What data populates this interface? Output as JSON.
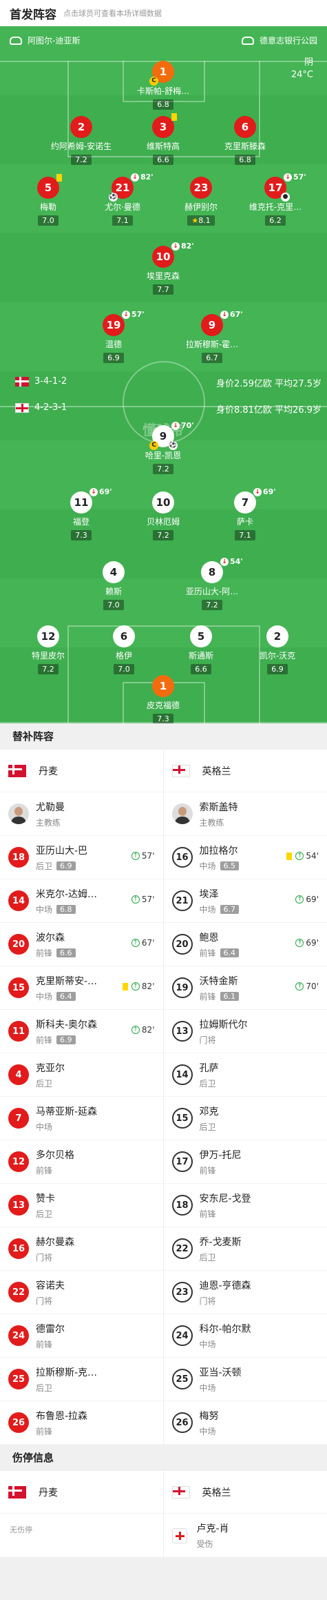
{
  "header": {
    "title": "首发阵容",
    "hint": "点击球员可查看本场详细数据"
  },
  "pitch": {
    "home_team": "阿图尔-迪亚斯",
    "away_team": "德意志银行公园",
    "weather": "阴",
    "temperature": "24°C",
    "watermark": "懂球帝",
    "dk_formation": "3-4-1-2",
    "dk_stats": "身价2.59亿欧  平均27.5岁",
    "en_formation": "4-2-3-1",
    "en_stats": "身价8.81亿欧  平均26.9岁"
  },
  "dk_players": [
    {
      "num": "1",
      "name": "卡斯帕-舒梅…",
      "rating": "6.8"
    },
    {
      "num": "2",
      "name": "约阿希姆-安诺生",
      "rating": "7.2"
    },
    {
      "num": "3",
      "name": "维斯特高",
      "rating": "6.6"
    },
    {
      "num": "6",
      "name": "克里斯滕森",
      "rating": "6.8"
    },
    {
      "num": "5",
      "name": "梅勒",
      "rating": "7.0"
    },
    {
      "num": "21",
      "name": "尤尔·曼德",
      "rating": "7.1",
      "sub": "82'"
    },
    {
      "num": "23",
      "name": "赫伊别尔",
      "rating": "8.1"
    },
    {
      "num": "17",
      "name": "维克托-克里…",
      "rating": "6.2",
      "sub": "57'"
    },
    {
      "num": "10",
      "name": "埃里克森",
      "rating": "7.7",
      "sub": "82'"
    },
    {
      "num": "19",
      "name": "温德",
      "rating": "6.9",
      "sub": "57'"
    },
    {
      "num": "9",
      "name": "拉斯穆斯-霍…",
      "rating": "6.7",
      "sub": "67'"
    }
  ],
  "en_players": [
    {
      "num": "9",
      "name": "哈里-凯恩",
      "rating": "7.2",
      "sub": "70'"
    },
    {
      "num": "11",
      "name": "福登",
      "rating": "7.3",
      "sub": "69'"
    },
    {
      "num": "10",
      "name": "贝林厄姆",
      "rating": "7.2"
    },
    {
      "num": "7",
      "name": "萨卡",
      "rating": "7.1",
      "sub": "69'"
    },
    {
      "num": "4",
      "name": "赖斯",
      "rating": "7.0"
    },
    {
      "num": "8",
      "name": "亚历山大-阿…",
      "rating": "7.2",
      "sub": "54'"
    },
    {
      "num": "12",
      "name": "特里皮尔",
      "rating": "7.2"
    },
    {
      "num": "6",
      "name": "格伊",
      "rating": "7.0"
    },
    {
      "num": "5",
      "name": "斯通斯",
      "rating": "6.6"
    },
    {
      "num": "2",
      "name": "凯尔-沃克",
      "rating": "6.9"
    },
    {
      "num": "1",
      "name": "皮克福德",
      "rating": "7.3"
    }
  ],
  "bench": {
    "title": "替补阵容",
    "dk_name": "丹麦",
    "en_name": "英格兰",
    "dk_coach": {
      "name": "尤勒曼",
      "role": "主教练"
    },
    "en_coach": {
      "name": "索斯盖特",
      "role": "主教练"
    },
    "dk": [
      {
        "num": "18",
        "name": "亚历山大-巴",
        "pos": "后卫",
        "rating": "6.9",
        "sub": "57'"
      },
      {
        "num": "14",
        "name": "米克尔-达姆…",
        "pos": "中场",
        "rating": "6.8",
        "sub": "57'"
      },
      {
        "num": "20",
        "name": "波尔森",
        "pos": "前锋",
        "rating": "6.6",
        "sub": "67'"
      },
      {
        "num": "15",
        "name": "克里斯蒂安-…",
        "pos": "中场",
        "rating": "6.4",
        "sub": "82'"
      },
      {
        "num": "11",
        "name": "斯科夫-奥尔森",
        "pos": "前锋",
        "rating": "6.9",
        "sub": "82'"
      },
      {
        "num": "4",
        "name": "克亚尔",
        "pos": "后卫"
      },
      {
        "num": "7",
        "name": "马蒂亚斯-延森",
        "pos": "中场"
      },
      {
        "num": "12",
        "name": "多尔贝格",
        "pos": "前锋"
      },
      {
        "num": "13",
        "name": "赞卡",
        "pos": "后卫"
      },
      {
        "num": "16",
        "name": "赫尔曼森",
        "pos": "门将"
      },
      {
        "num": "22",
        "name": "容诺夫",
        "pos": "门将"
      },
      {
        "num": "24",
        "name": "德雷尔",
        "pos": "前锋"
      },
      {
        "num": "25",
        "name": "拉斯穆斯-克…",
        "pos": "后卫"
      },
      {
        "num": "26",
        "name": "布鲁恩-拉森",
        "pos": "前锋"
      }
    ],
    "en": [
      {
        "num": "16",
        "name": "加拉格尔",
        "pos": "中场",
        "rating": "6.5",
        "sub": "54'"
      },
      {
        "num": "21",
        "name": "埃泽",
        "pos": "中场",
        "rating": "6.7",
        "sub": "69'"
      },
      {
        "num": "20",
        "name": "鲍恩",
        "pos": "前锋",
        "rating": "6.4",
        "sub": "69'"
      },
      {
        "num": "19",
        "name": "沃特金斯",
        "pos": "前锋",
        "rating": "6.1",
        "sub": "70'"
      },
      {
        "num": "13",
        "name": "拉姆斯代尔",
        "pos": "门将"
      },
      {
        "num": "14",
        "name": "孔萨",
        "pos": "后卫"
      },
      {
        "num": "15",
        "name": "邓克",
        "pos": "后卫"
      },
      {
        "num": "17",
        "name": "伊万-托尼",
        "pos": "前锋"
      },
      {
        "num": "18",
        "name": "安东尼-戈登",
        "pos": "前锋"
      },
      {
        "num": "22",
        "name": "乔-戈麦斯",
        "pos": "后卫"
      },
      {
        "num": "23",
        "name": "迪恩-亨德森",
        "pos": "门将"
      },
      {
        "num": "24",
        "name": "科尔-帕尔默",
        "pos": "中场"
      },
      {
        "num": "25",
        "name": "亚当-沃顿",
        "pos": "中场"
      },
      {
        "num": "26",
        "name": "梅努",
        "pos": "中场"
      }
    ]
  },
  "injury": {
    "title": "伤停信息",
    "dk_name": "丹麦",
    "en_name": "英格兰",
    "dk_none": "无伤停",
    "en_player": {
      "name": "卢克-肖",
      "status": "受伤"
    }
  }
}
